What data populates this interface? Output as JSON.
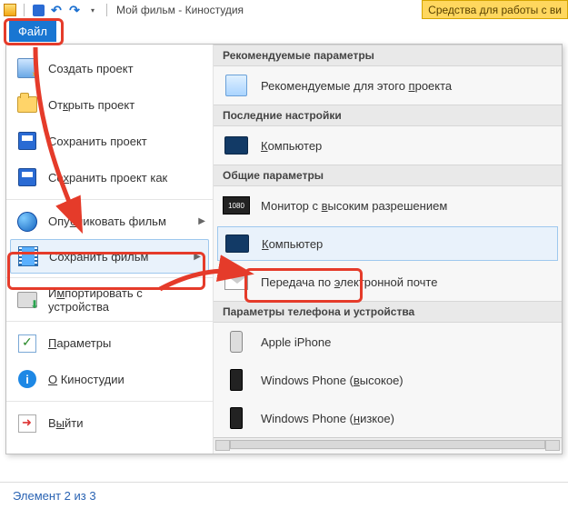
{
  "window": {
    "title": "Мой фильм - Киностудия"
  },
  "ribbon_hint": "Средства для работы с ви",
  "file_tab": "Файл",
  "left_menu": {
    "new_project": "Создать проект",
    "open_project_pre": "От",
    "open_project_u": "к",
    "open_project_post": "рыть проект",
    "save_project": "Сохранить проект",
    "save_project_as_pre": "Со",
    "save_project_as_u": "х",
    "save_project_as_post": "ранить проект как",
    "publish_movie_pre": "Опу",
    "publish_movie_u": "б",
    "publish_movie_post": "ликовать фильм",
    "save_movie": "Сохранить фильм",
    "import_device_pre": "И",
    "import_device_u": "м",
    "import_device_post": "портировать с устройства",
    "params_u": "П",
    "params_post": "араметры",
    "about_u": "О",
    "about_post": " Киностудии",
    "exit_pre": "В",
    "exit_u": "ы",
    "exit_post": "йти"
  },
  "right": {
    "sec_recommended": "Рекомендуемые параметры",
    "rec_item_pre": "Рекомендуемые для этого ",
    "rec_item_u": "п",
    "rec_item_post": "роекта",
    "sec_recent": "Последние настройки",
    "recent_computer_u": "К",
    "recent_computer_post": "омпьютер",
    "sec_common": "Общие параметры",
    "hires_pre": "Монитор с ",
    "hires_u": "в",
    "hires_post": "ысоким разрешением",
    "computer_u": "К",
    "computer_post": "омпьютер",
    "email_pre": "Передача по ",
    "email_u": "э",
    "email_post": "лектронной почте",
    "sec_phone": "Параметры телефона и устройства",
    "iphone": "Apple iPhone",
    "wp_high_pre": "Windows Phone (",
    "wp_high_u": "в",
    "wp_high_post": "ысокое)",
    "wp_low_pre": "Windows Phone (",
    "wp_low_u": "н",
    "wp_low_post": "изкое)"
  },
  "status": "Элемент 2 из 3",
  "icons": {
    "hires_badge": "1080"
  }
}
